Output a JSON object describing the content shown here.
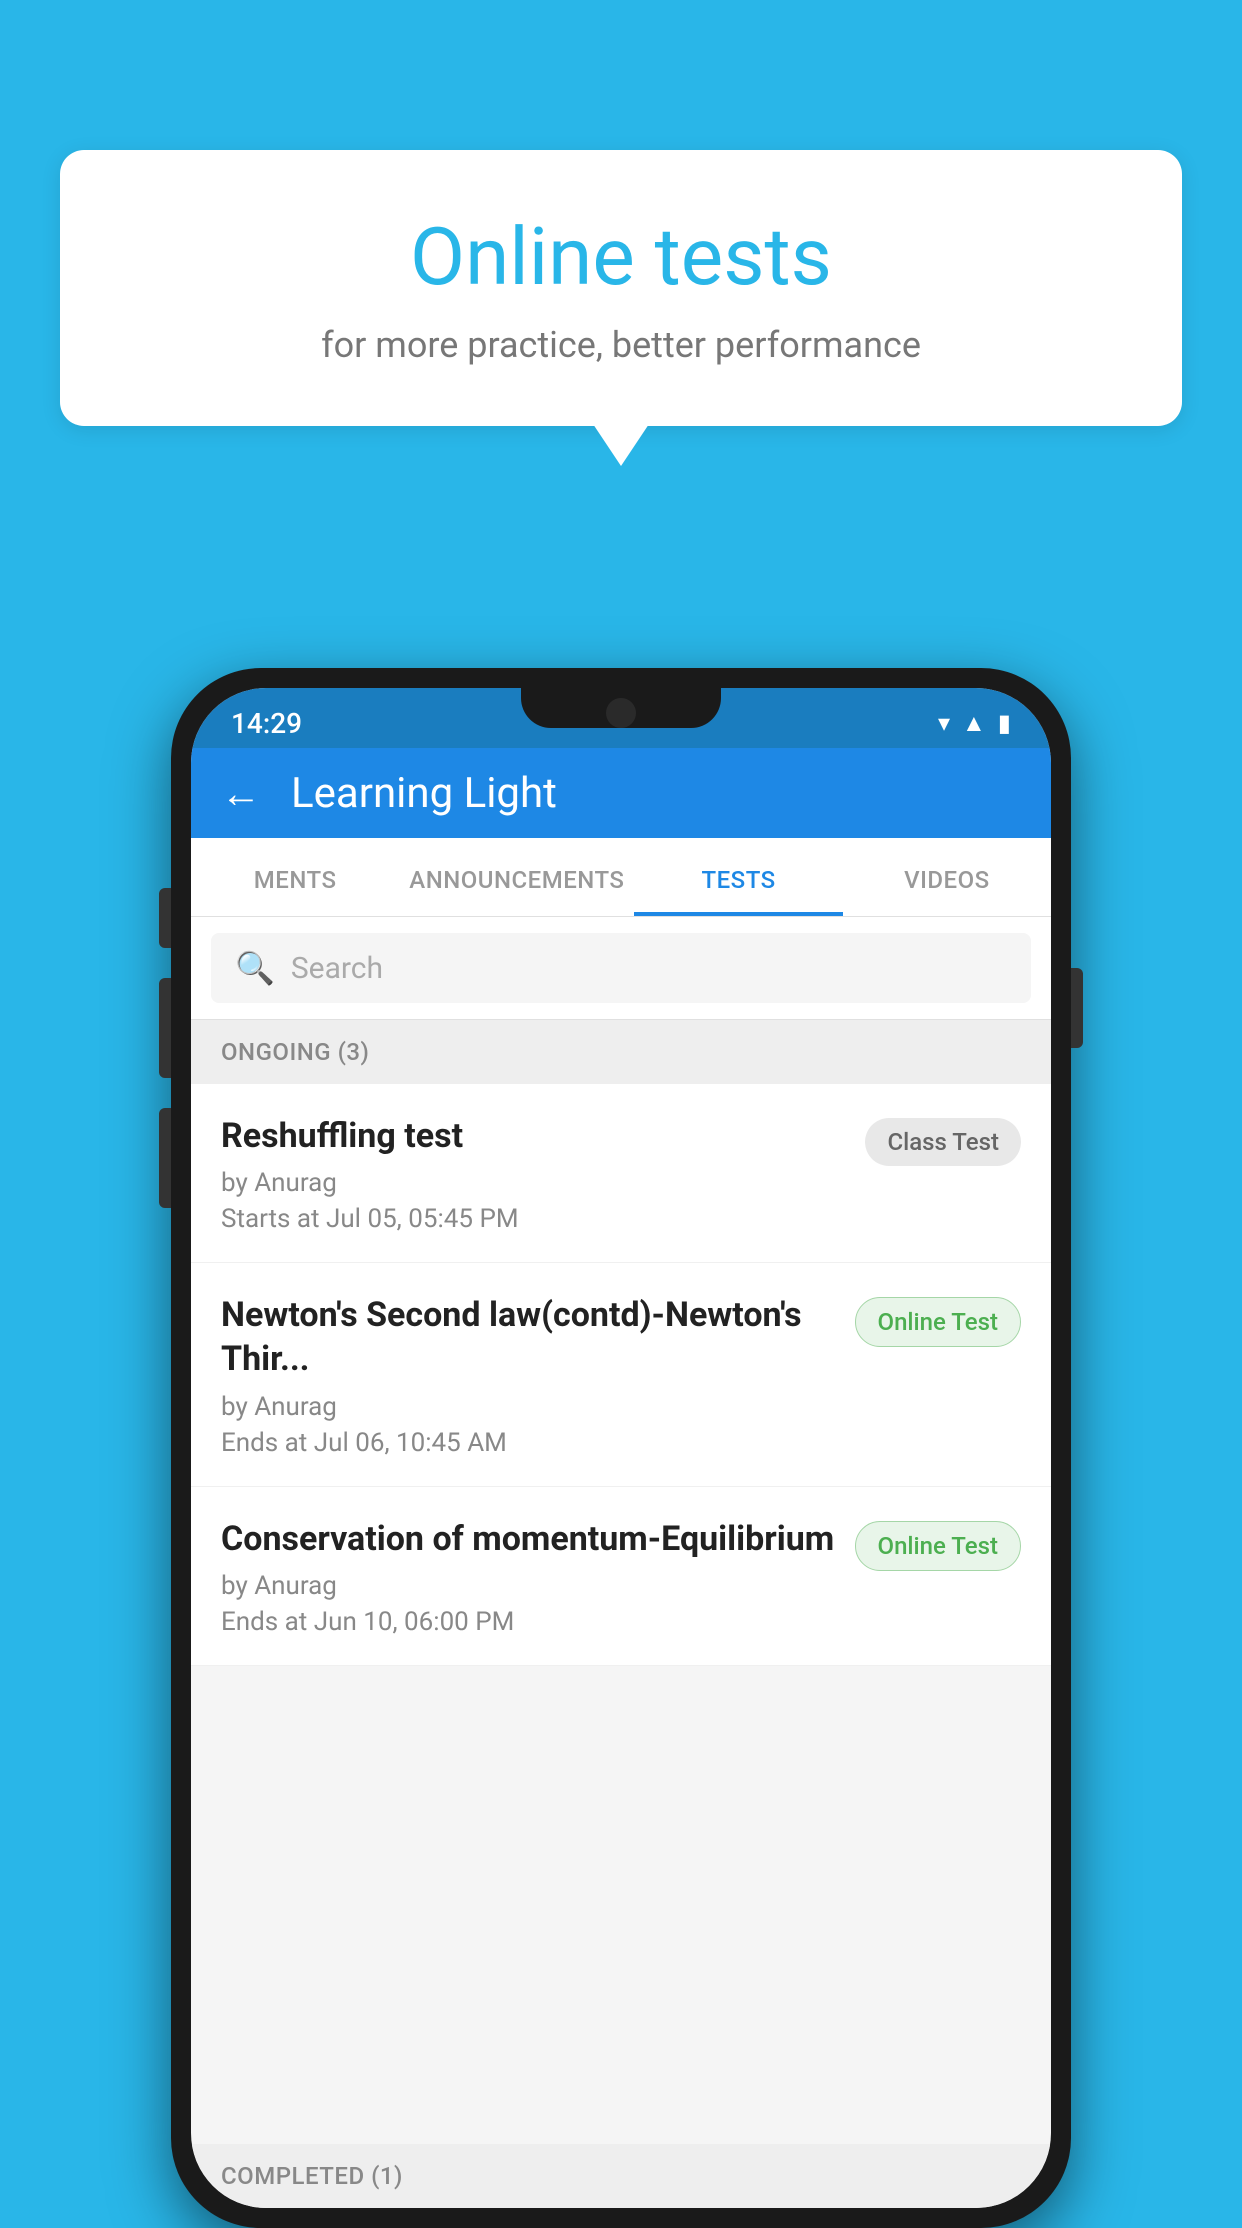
{
  "background": {
    "color": "#29b6e8"
  },
  "speech_bubble": {
    "title": "Online tests",
    "subtitle": "for more practice, better performance"
  },
  "phone": {
    "status_bar": {
      "time": "14:29",
      "icons": [
        "wifi",
        "signal",
        "battery"
      ]
    },
    "header": {
      "title": "Learning Light",
      "back_label": "←"
    },
    "tabs": [
      {
        "label": "MENTS",
        "active": false
      },
      {
        "label": "ANNOUNCEMENTS",
        "active": false
      },
      {
        "label": "TESTS",
        "active": true
      },
      {
        "label": "VIDEOS",
        "active": false
      }
    ],
    "search": {
      "placeholder": "Search"
    },
    "ongoing_section": {
      "label": "ONGOING (3)"
    },
    "tests": [
      {
        "name": "Reshuffling test",
        "author": "by Anurag",
        "date": "Starts at  Jul 05, 05:45 PM",
        "badge": "Class Test",
        "badge_type": "class"
      },
      {
        "name": "Newton's Second law(contd)-Newton's Thir...",
        "author": "by Anurag",
        "date": "Ends at  Jul 06, 10:45 AM",
        "badge": "Online Test",
        "badge_type": "online"
      },
      {
        "name": "Conservation of momentum-Equilibrium",
        "author": "by Anurag",
        "date": "Ends at  Jun 10, 06:00 PM",
        "badge": "Online Test",
        "badge_type": "online"
      }
    ],
    "completed_section": {
      "label": "COMPLETED (1)"
    }
  }
}
